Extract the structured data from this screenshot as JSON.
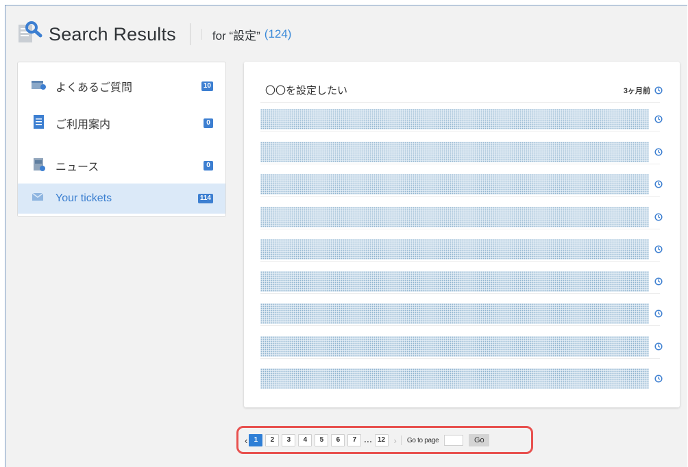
{
  "header": {
    "title": "Search Results",
    "for_text": "for “設定”",
    "count": "(124)",
    "icon": "search-document-icon"
  },
  "sidebar": {
    "items": [
      {
        "label": "よくあるご質問",
        "badge": "10",
        "icon": "faq-icon"
      },
      {
        "label": "ご利用案内",
        "badge": "0",
        "icon": "guide-document-icon"
      },
      {
        "label": "ニュース",
        "badge": "0",
        "icon": "news-icon"
      },
      {
        "label": "Your tickets",
        "badge": "114",
        "icon": "envelope-icon",
        "active": true
      }
    ]
  },
  "results": {
    "first": {
      "title": "〇〇を設定したい",
      "time": "3ヶ月前"
    },
    "redacted_rows": 9,
    "icon": "clock-icon"
  },
  "pagination": {
    "current": "1",
    "pages": [
      "1",
      "2",
      "3",
      "4",
      "5",
      "6",
      "7"
    ],
    "ellipsis": "...",
    "last": "12",
    "goto_label": "Go to page",
    "go_button": "Go",
    "highlight_color": "#e8514f"
  },
  "colors": {
    "accent": "#3b8ad9",
    "badge": "#3d7fd1",
    "active_bg": "#dbe9f8"
  }
}
